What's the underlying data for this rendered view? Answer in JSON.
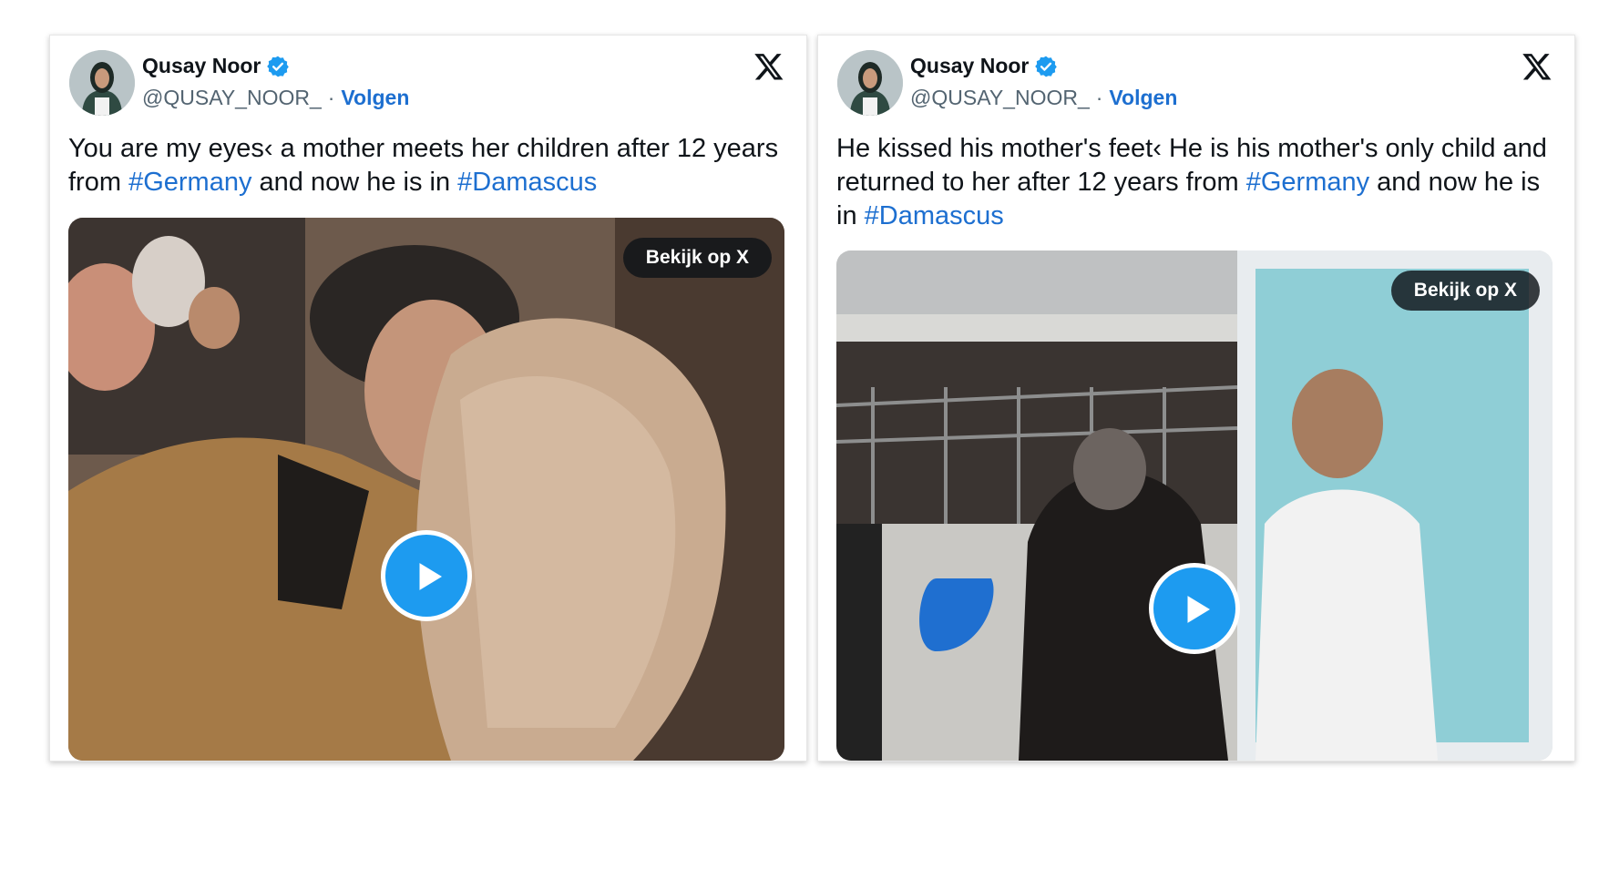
{
  "tweets": [
    {
      "author": {
        "name": "Qusay Noor",
        "handle": "@QUSAY_NOOR_",
        "verified": true
      },
      "separator": "·",
      "follow_label": "Volgen",
      "text_parts": [
        {
          "t": "You are my eyes‹ a mother meets her children after 12 years from "
        },
        {
          "t": "#Germany",
          "tag": true
        },
        {
          "t": " and now he is in "
        },
        {
          "t": "#Damascus",
          "tag": true
        }
      ],
      "media": {
        "watch_label": "Bekijk op X",
        "type": "video"
      }
    },
    {
      "author": {
        "name": "Qusay Noor",
        "handle": "@QUSAY_NOOR_",
        "verified": true
      },
      "separator": "·",
      "follow_label": "Volgen",
      "text_parts": [
        {
          "t": "He kissed his mother's feet‹ He is his mother's only child and returned to her after 12 years from "
        },
        {
          "t": "#Germany",
          "tag": true
        },
        {
          "t": " and now he is in "
        },
        {
          "t": "#Damascus",
          "tag": true
        }
      ],
      "media": {
        "watch_label": "Bekijk op X",
        "type": "video"
      }
    }
  ],
  "icons": {
    "verified": "verified-badge-icon",
    "brand": "x-logo-icon",
    "play": "play-icon"
  },
  "colors": {
    "accent": "#1d6fd0",
    "play_button": "#1d9bf0",
    "text": "#0f1419",
    "muted": "#536471"
  }
}
